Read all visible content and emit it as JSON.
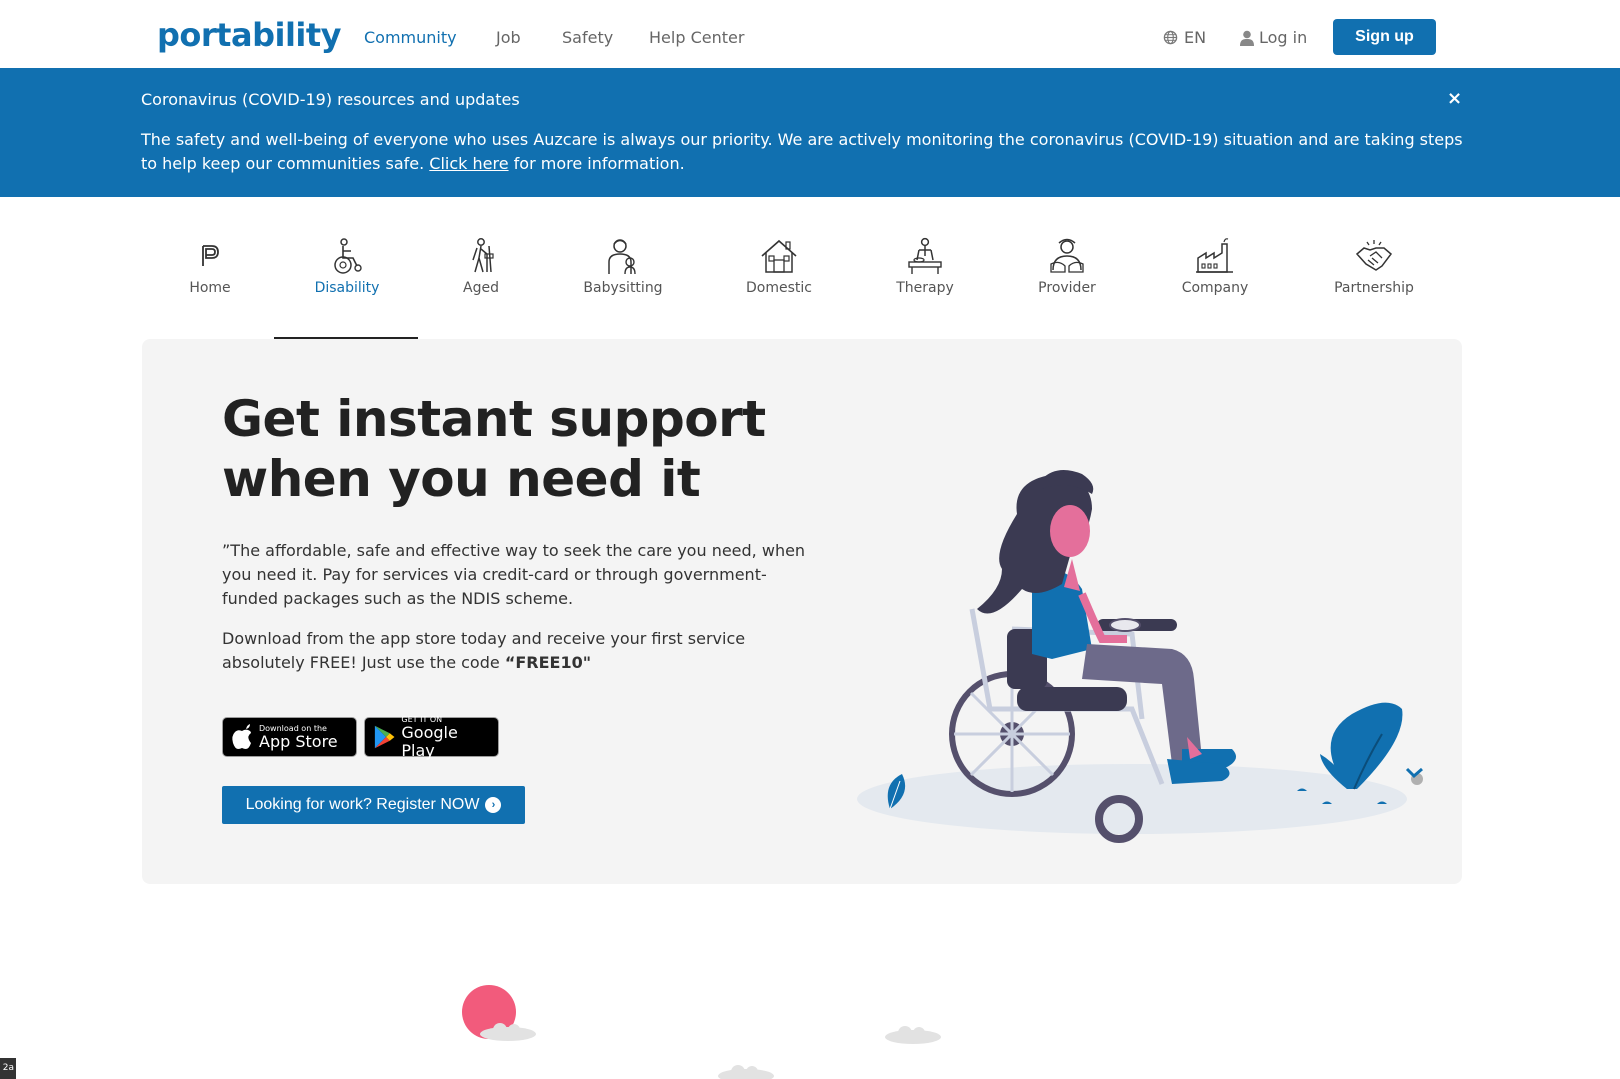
{
  "brand": {
    "logo": "portability",
    "accent": "#1170b0"
  },
  "nav": {
    "links": [
      {
        "label": "Community",
        "active": true
      },
      {
        "label": "Job",
        "active": false
      },
      {
        "label": "Safety",
        "active": false
      },
      {
        "label": "Help Center",
        "active": false
      }
    ],
    "language": "EN",
    "login": "Log in",
    "signup": "Sign up"
  },
  "banner": {
    "title": "Coronavirus (COVID-19) resources and updates",
    "close_icon": "×",
    "body_before": "The safety and well-being of everyone who uses Auzcare is always our priority. We are actively monitoring the coronavirus (COVID-19) situation and are taking steps to help keep our communities safe. ",
    "link": "Click here",
    "body_after": " for more information."
  },
  "categories": [
    {
      "label": "Home",
      "icon": "portability-p-icon",
      "active": false
    },
    {
      "label": "Disability",
      "icon": "wheelchair-icon",
      "active": true
    },
    {
      "label": "Aged",
      "icon": "elderly-walker-icon",
      "active": false
    },
    {
      "label": "Babysitting",
      "icon": "babysitter-icon",
      "active": false
    },
    {
      "label": "Domestic",
      "icon": "house-icon",
      "active": false
    },
    {
      "label": "Therapy",
      "icon": "massage-therapy-icon",
      "active": false
    },
    {
      "label": "Provider",
      "icon": "caregiver-icon",
      "active": false
    },
    {
      "label": "Company",
      "icon": "factory-icon",
      "active": false
    },
    {
      "label": "Partnership",
      "icon": "handshake-icon",
      "active": false
    }
  ],
  "hero": {
    "title_line1": "Get instant support",
    "title_line2": "when you need it",
    "paragraph1": "”The affordable, safe and effective way to seek the care you need, when you need it. Pay for services via credit-card or through government-funded packages such as the NDIS scheme.",
    "paragraph2_before": "Download from the app store today and receive your first service absolutely FREE! Just use the code ",
    "paragraph2_code": "“FREE10\"",
    "app_store": {
      "small": "Download on the",
      "big": "App Store"
    },
    "google_play": {
      "small": "GET IT ON",
      "big": "Google Play"
    },
    "register": "Looking for work? Register NOW"
  },
  "corner_tag": "2a"
}
